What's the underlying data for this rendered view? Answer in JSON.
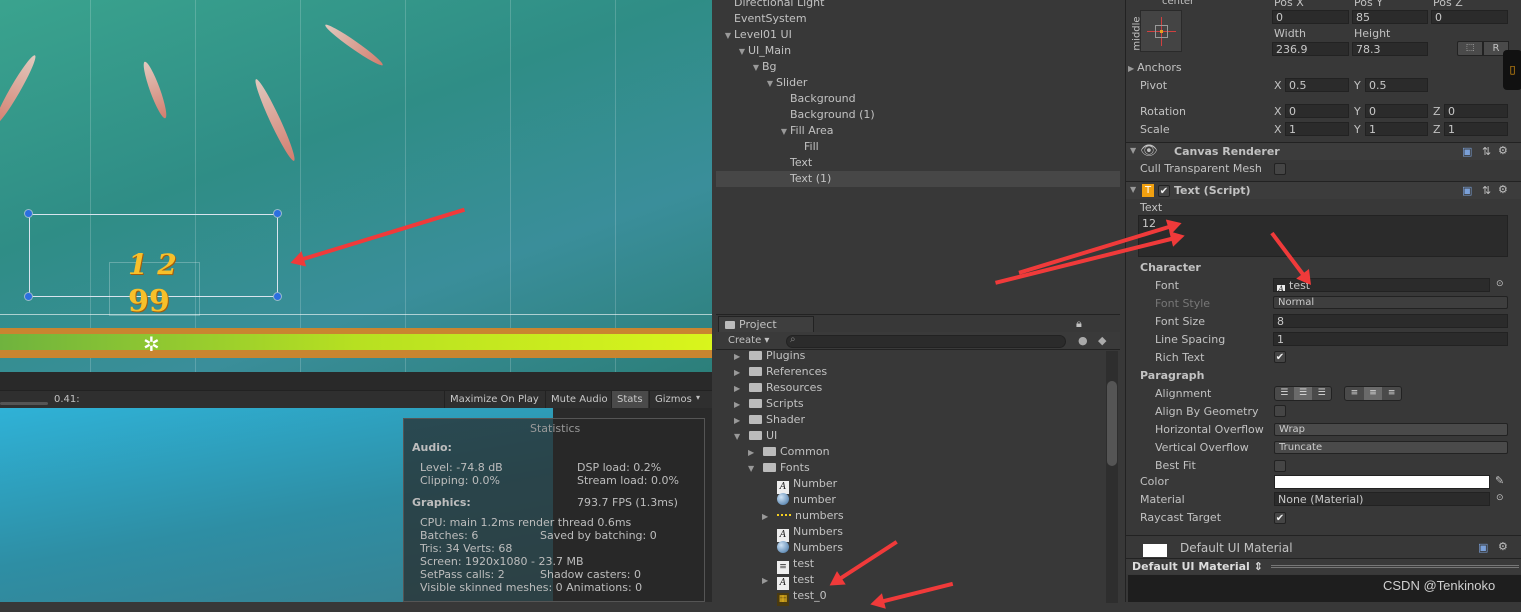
{
  "scene": {
    "text_top": "1 2",
    "text_bottom": "99"
  },
  "game_toolbar": {
    "scale_value": "0.41:",
    "maximize_on_play": "Maximize On Play",
    "mute_audio": "Mute Audio",
    "stats": "Stats",
    "gizmos": "Gizmos"
  },
  "stats": {
    "title": "Statistics",
    "audio_heading": "Audio:",
    "level": "Level: -74.8 dB",
    "clipping": "Clipping: 0.0%",
    "dsp_load": "DSP load: 0.2%",
    "stream_load": "Stream load: 0.0%",
    "graphics_heading": "Graphics:",
    "fps": "793.7 FPS (1.3ms)",
    "cpu": "CPU: main 1.2ms  render thread 0.6ms",
    "batches": "Batches: 6",
    "saved_by_batching": "Saved by batching: 0",
    "tris_verts": "Tris: 34   Verts: 68",
    "screen": "Screen: 1920x1080 - 23.7 MB",
    "setpass": "SetPass calls: 2",
    "shadow_casters": "Shadow casters: 0",
    "skinned": "Visible skinned meshes: 0  Animations: 0"
  },
  "hierarchy": {
    "items": [
      {
        "label": "Directional Light",
        "depth": 0,
        "expanded": null
      },
      {
        "label": "EventSystem",
        "depth": 0,
        "expanded": null
      },
      {
        "label": "Level01 UI",
        "depth": 0,
        "expanded": true
      },
      {
        "label": "UI_Main",
        "depth": 1,
        "expanded": true
      },
      {
        "label": "Bg",
        "depth": 2,
        "expanded": true
      },
      {
        "label": "Slider",
        "depth": 3,
        "expanded": true
      },
      {
        "label": "Background",
        "depth": 4,
        "expanded": null
      },
      {
        "label": "Background (1)",
        "depth": 4,
        "expanded": null
      },
      {
        "label": "Fill Area",
        "depth": 4,
        "expanded": true
      },
      {
        "label": "Fill",
        "depth": 5,
        "expanded": null
      },
      {
        "label": "Text",
        "depth": 4,
        "expanded": null
      },
      {
        "label": "Text (1)",
        "depth": 4,
        "expanded": null,
        "selected": true
      }
    ]
  },
  "project": {
    "tab": "Project",
    "create": "Create",
    "search_placeholder": "",
    "items": [
      {
        "label": "Plugins",
        "depth": 0,
        "icon": "folder",
        "arrow": "right"
      },
      {
        "label": "References",
        "depth": 0,
        "icon": "folder",
        "arrow": "right"
      },
      {
        "label": "Resources",
        "depth": 0,
        "icon": "folder",
        "arrow": "right"
      },
      {
        "label": "Scripts",
        "depth": 0,
        "icon": "folder",
        "arrow": "right"
      },
      {
        "label": "Shader",
        "depth": 0,
        "icon": "folder",
        "arrow": "right"
      },
      {
        "label": "UI",
        "depth": 0,
        "icon": "folder",
        "arrow": "down"
      },
      {
        "label": "Common",
        "depth": 1,
        "icon": "folder",
        "arrow": "right"
      },
      {
        "label": "Fonts",
        "depth": 1,
        "icon": "folder",
        "arrow": "down"
      },
      {
        "label": "Number",
        "depth": 2,
        "icon": "font",
        "arrow": ""
      },
      {
        "label": "number",
        "depth": 2,
        "icon": "material",
        "arrow": ""
      },
      {
        "label": "numbers",
        "depth": 2,
        "icon": "sprite",
        "arrow": "right"
      },
      {
        "label": "Numbers",
        "depth": 2,
        "icon": "font",
        "arrow": ""
      },
      {
        "label": "Numbers",
        "depth": 2,
        "icon": "material",
        "arrow": ""
      },
      {
        "label": "test",
        "depth": 2,
        "icon": "text-file",
        "arrow": ""
      },
      {
        "label": "test",
        "depth": 2,
        "icon": "font",
        "arrow": "right"
      },
      {
        "label": "test_0",
        "depth": 2,
        "icon": "texture",
        "arrow": ""
      }
    ]
  },
  "inspector": {
    "anchor_preset": {
      "h": "center",
      "v": "middle"
    },
    "pos_x_label": "Pos X",
    "pos_y_label": "Pos Y",
    "pos_z_label": "Pos Z",
    "pos_x": "0",
    "pos_y": "85",
    "pos_z": "0",
    "width_label": "Width",
    "height_label": "Height",
    "width": "236.9",
    "height": "78.3",
    "r_button": "R",
    "anchors": "Anchors",
    "pivot": "Pivot",
    "pivot_x": "0.5",
    "pivot_y": "0.5",
    "rotation": "Rotation",
    "rot_x": "0",
    "rot_y": "0",
    "rot_z": "0",
    "scale": "Scale",
    "scale_x": "1",
    "scale_y": "1",
    "scale_z": "1",
    "x": "X",
    "y": "Y",
    "z": "Z",
    "canvas_renderer": "Canvas Renderer",
    "cull_transparent_mesh": "Cull Transparent Mesh",
    "text_script": "Text (Script)",
    "text_label": "Text",
    "text_value": "12",
    "character": "Character",
    "font": "Font",
    "font_value": "test",
    "font_style": "Font Style",
    "font_style_value": "Normal",
    "font_size": "Font Size",
    "font_size_value": "8",
    "line_spacing": "Line Spacing",
    "line_spacing_value": "1",
    "rich_text": "Rich Text",
    "rich_text_checked": true,
    "paragraph": "Paragraph",
    "alignment": "Alignment",
    "align_by_geometry": "Align By Geometry",
    "horizontal_overflow": "Horizontal Overflow",
    "horizontal_overflow_value": "Wrap",
    "vertical_overflow": "Vertical Overflow",
    "vertical_overflow_value": "Truncate",
    "best_fit": "Best Fit",
    "color": "Color",
    "color_value": "#ffffff",
    "material": "Material",
    "material_value": "None (Material)",
    "raycast_target": "Raycast Target",
    "raycast_checked": true,
    "default_ui_material": "Default UI Material",
    "material_preview_dropdown": "Default UI Material"
  },
  "watermark": "CSDN @Tenkinoko",
  "colors": {
    "annotation_arrow": "#f03a3a",
    "selection_handle": "#2c6fe0",
    "text_gold": "#f7c02a"
  }
}
